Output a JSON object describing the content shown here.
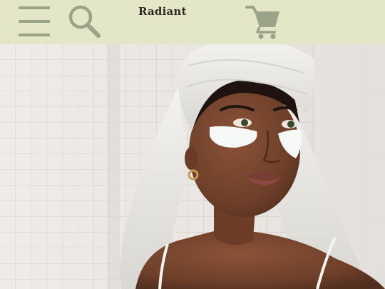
{
  "header": {
    "brand": "Radiant",
    "icons": {
      "menu": "hamburger-menu-icon",
      "search": "search-icon",
      "cart": "shopping-cart-icon"
    },
    "background": "#e3e7c8",
    "icon_color": "#9ba388"
  },
  "hero": {
    "image": "woman-with-towel-and-under-eye-patches-photo"
  }
}
